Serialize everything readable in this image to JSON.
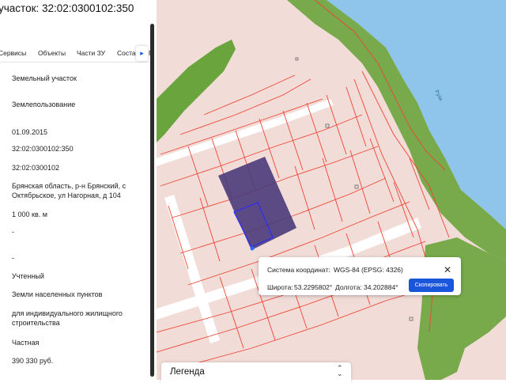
{
  "panel": {
    "title": "участок: 32:02:0300102:350",
    "tabs": [
      "Сервисы",
      "Объекты",
      "Части ЗУ",
      "Соста",
      "Г"
    ],
    "values": [
      "Земельный участок",
      "Землепользование",
      "01.09.2015",
      "32:02:0300102:350",
      "32:02:0300102",
      "Брянская область, р-н Брянский, с Октябрьское, ул Нагорная, д 104",
      "1 000 кв. м",
      "-",
      "-",
      "Учтенный",
      "Земли населенных пунктов",
      "для индивидуального жилищного строительства",
      "Частная",
      "390 330 руб."
    ]
  },
  "map": {
    "river_label": "Руза",
    "colors": {
      "parcel_fill": "#f2dcd8",
      "parcel_border": "#ee4433",
      "selected_parcel": "#4a3a7a",
      "forest": "#6aa43c",
      "water": "#8fc5ea",
      "road": "#ffffff",
      "sand": "#e9e8e4"
    },
    "coord_popup": {
      "system_label": "Система координат:",
      "system_value": "WGS-84 (EPSG: 4326)",
      "lat_label": "Широта:",
      "lat_value": "53.2295802°",
      "lon_label": "Долгота:",
      "lon_value": "34.202884°",
      "copy_label": "Скопировать"
    },
    "legend": {
      "label": "Легенда"
    }
  }
}
